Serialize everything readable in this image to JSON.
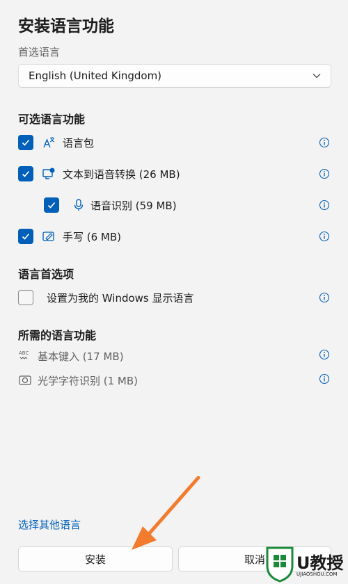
{
  "dialog": {
    "title": "安装语言功能",
    "preferred_language_label": "首选语言",
    "selected_language": "English (United Kingdom)"
  },
  "optional_features": {
    "heading": "可选语言功能",
    "items": [
      {
        "label": "语言包",
        "checked": true,
        "icon": "language-pack-icon"
      },
      {
        "label": "文本到语音转换 (26 MB)",
        "checked": true,
        "icon": "text-to-speech-icon"
      },
      {
        "label": "语音识别 (59 MB)",
        "checked": true,
        "icon": "microphone-icon"
      },
      {
        "label": "手写 (6 MB)",
        "checked": true,
        "icon": "handwriting-icon"
      }
    ]
  },
  "preferences": {
    "heading": "语言首选项",
    "display_language": {
      "label": "设置为我的 Windows 显示语言",
      "checked": false
    }
  },
  "required_features": {
    "heading": "所需的语言功能",
    "items": [
      {
        "label": "基本键入 (17 MB)",
        "icon": "abc-typing-icon"
      },
      {
        "label": "光学字符识别 (1 MB)",
        "icon": "ocr-icon"
      }
    ]
  },
  "footer": {
    "choose_other_link": "选择其他语言",
    "install_button": "安装",
    "cancel_button": "取消"
  },
  "watermark": {
    "big": "U教授",
    "small": "UJIAOSHOU.COM"
  },
  "colors": {
    "accent": "#005fb8",
    "arrow": "#f27b2d",
    "watermark": "#1a8a3a"
  }
}
